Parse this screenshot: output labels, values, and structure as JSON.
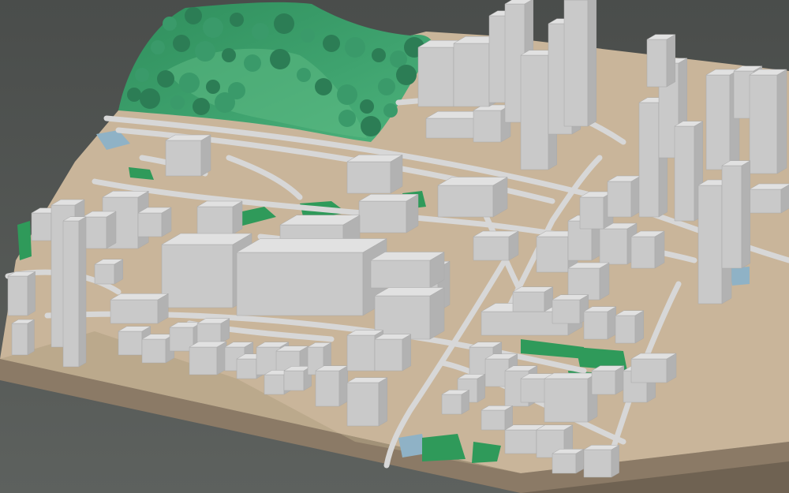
{
  "scene": {
    "kind": "3d-city-terrain-model",
    "palette": {
      "background_top": "#4a4d4b",
      "background_bottom": "#5d615e",
      "ground": "#c9b59a",
      "ground_shadow": "#b3a184",
      "slab_front": "#8b7a66",
      "slab_side": "#6f6252",
      "forest": "#3a9a6a",
      "forest_dark": "#2c7d55",
      "park_patch": "#2f9a5a",
      "building_top": "#e1e1e1",
      "building_left": "#c9c9c9",
      "building_right": "#b2b2b2",
      "road": "#d7d7d7",
      "water": "#8fb2c6"
    }
  }
}
